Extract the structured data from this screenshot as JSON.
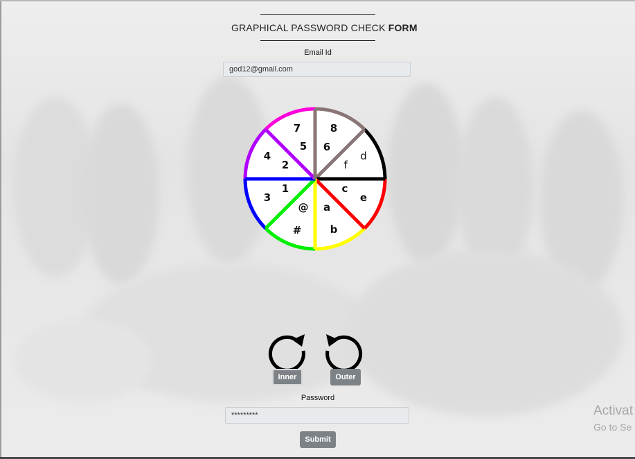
{
  "form": {
    "title_prefix": "GRAPHICAL PASSWORD CHECK ",
    "title_bold": "FORM",
    "email_label": "Email Id",
    "email_value": "god12@gmail.com",
    "password_label": "Password",
    "password_value": "*********",
    "submit_label": "Submit"
  },
  "wheel": {
    "outer_labels": [
      "8",
      "d",
      "e",
      "b",
      "#",
      "3",
      "4",
      "7"
    ],
    "inner_labels": [
      "6",
      "f",
      "c",
      "a",
      "@",
      "1",
      "2",
      "5"
    ],
    "segment_colors": [
      "#8a7575",
      "#000000",
      "#ff0000",
      "#ffff00",
      "#00ee00",
      "#0000ff",
      "#b000ff",
      "#ff00dd"
    ]
  },
  "controls": {
    "inner_label": "Inner",
    "outer_label": "Outer",
    "inner_icon": "rotate-clockwise-icon",
    "outer_icon": "rotate-counterclockwise-icon"
  },
  "watermark": {
    "line1": "Activat",
    "line2": "Go to Se"
  }
}
